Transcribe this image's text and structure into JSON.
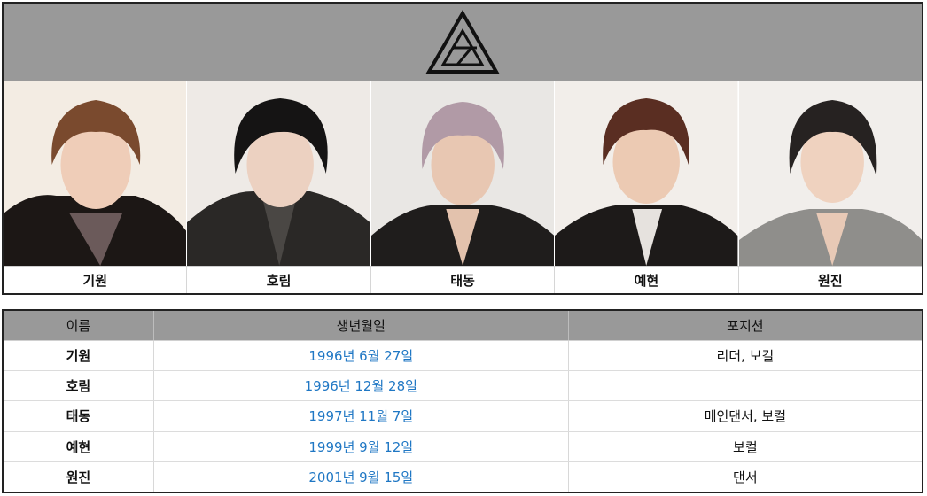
{
  "colors": {
    "header_gray": "#999999",
    "link_blue": "#1f77c4",
    "border_dark": "#222222"
  },
  "logo": {
    "icon": "triangle-logo-icon"
  },
  "members": [
    {
      "name": "기원",
      "photo": "member-photo-kiwon"
    },
    {
      "name": "호림",
      "photo": "member-photo-horim"
    },
    {
      "name": "태동",
      "photo": "member-photo-taedong"
    },
    {
      "name": "예현",
      "photo": "member-photo-yehyun"
    },
    {
      "name": "원진",
      "photo": "member-photo-wonjin"
    }
  ],
  "table": {
    "headers": [
      "이름",
      "생년월일",
      "포지션"
    ],
    "rows": [
      {
        "name": "기원",
        "birth": "1996년 6월 27일",
        "position": "리더, 보컬"
      },
      {
        "name": "호림",
        "birth": "1996년 12월 28일",
        "position": ""
      },
      {
        "name": "태동",
        "birth": "1997년 11월 7일",
        "position": "메인댄서, 보컬"
      },
      {
        "name": "예현",
        "birth": "1999년 9월 12일",
        "position": "보컬"
      },
      {
        "name": "원진",
        "birth": "2001년 9월 15일",
        "position": "댄서"
      }
    ]
  }
}
